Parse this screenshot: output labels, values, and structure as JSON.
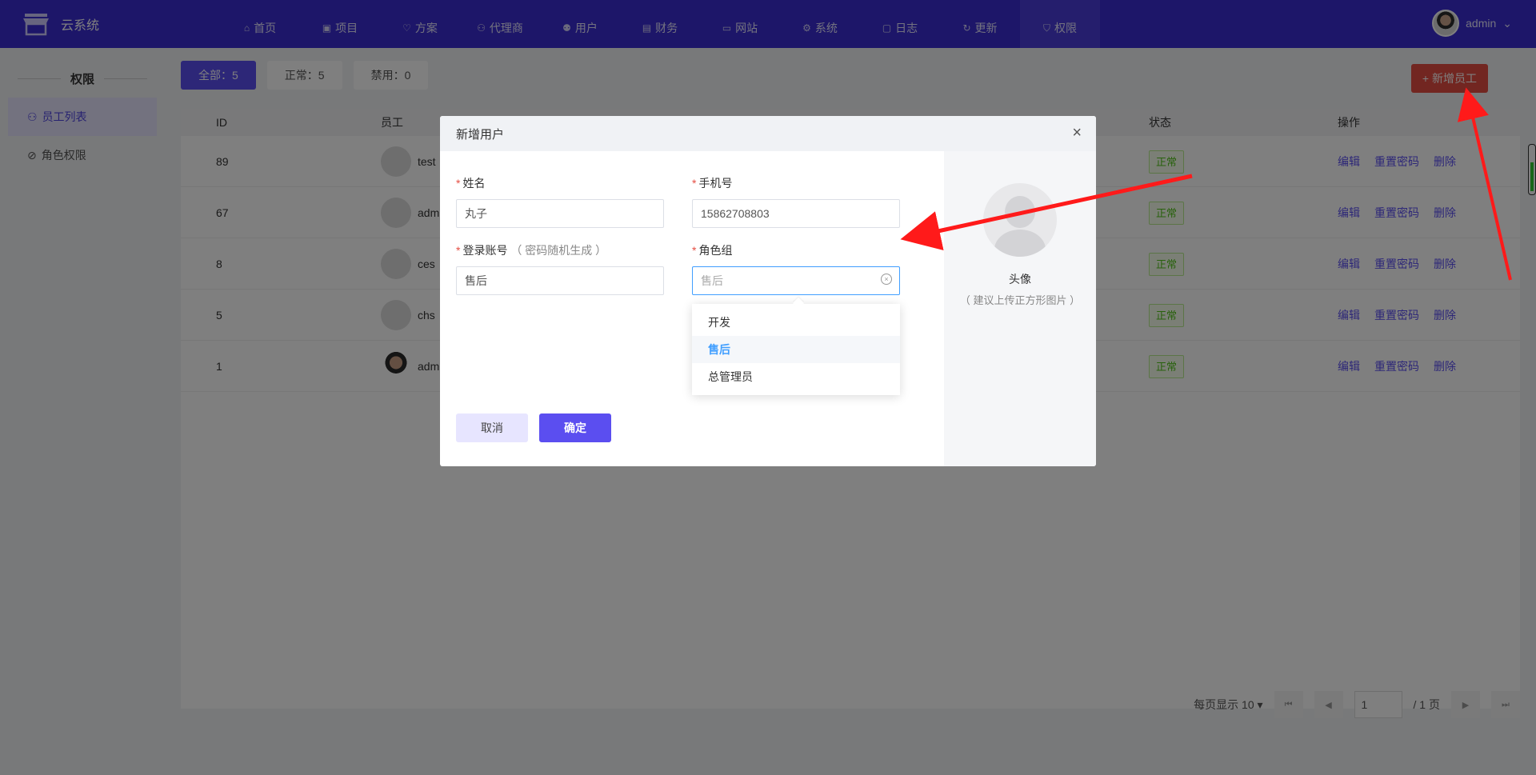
{
  "app": {
    "title": "云系统"
  },
  "nav": [
    {
      "label": "首页",
      "icon": "home-icon"
    },
    {
      "label": "项目",
      "icon": "briefcase-icon"
    },
    {
      "label": "方案",
      "icon": "heart-icon"
    },
    {
      "label": "代理商",
      "icon": "users-icon"
    },
    {
      "label": "用户",
      "icon": "user-icon"
    },
    {
      "label": "财务",
      "icon": "wallet-icon"
    },
    {
      "label": "网站",
      "icon": "browser-icon"
    },
    {
      "label": "系统",
      "icon": "gear-icon"
    },
    {
      "label": "日志",
      "icon": "doc-icon"
    },
    {
      "label": "更新",
      "icon": "refresh-icon"
    },
    {
      "label": "权限",
      "icon": "shield-icon"
    }
  ],
  "user": {
    "name": "admin"
  },
  "sidebar": {
    "title": "权限",
    "items": [
      {
        "label": "员工列表"
      },
      {
        "label": "角色权限"
      }
    ]
  },
  "filters": [
    {
      "label": "全部：5"
    },
    {
      "label": "正常：5"
    },
    {
      "label": "禁用：0"
    }
  ],
  "add_button": "+ 新增员工",
  "table": {
    "headers": {
      "id": "ID",
      "employee": "员工",
      "status": "状态",
      "ops": "操作"
    },
    "rows": [
      {
        "id": "89",
        "name": "test",
        "status": "正常"
      },
      {
        "id": "67",
        "name": "adm",
        "status": "正常"
      },
      {
        "id": "8",
        "name": "ces",
        "status": "正常"
      },
      {
        "id": "5",
        "name": "chs",
        "status": "正常"
      },
      {
        "id": "1",
        "name": "adm",
        "status": "正常"
      }
    ],
    "ops": {
      "edit": "编辑",
      "reset": "重置密码",
      "delete": "删除"
    }
  },
  "pager": {
    "page_size": "每页显示 10",
    "page": "1",
    "total": "/ 1 页"
  },
  "modal": {
    "title": "新增用户",
    "name_label": "姓名",
    "name_value": "丸子",
    "phone_label": "手机号",
    "phone_value": "15862708803",
    "account_label": "登录账号",
    "account_hint": "（ 密码随机生成 ）",
    "account_value": "售后",
    "role_label": "角色组",
    "role_placeholder": "售后",
    "role_options": [
      "开发",
      "售后",
      "总管理员"
    ],
    "avatar_label": "头像",
    "avatar_hint": "（ 建议上传正方形图片 ）",
    "cancel": "取消",
    "confirm": "确定"
  }
}
